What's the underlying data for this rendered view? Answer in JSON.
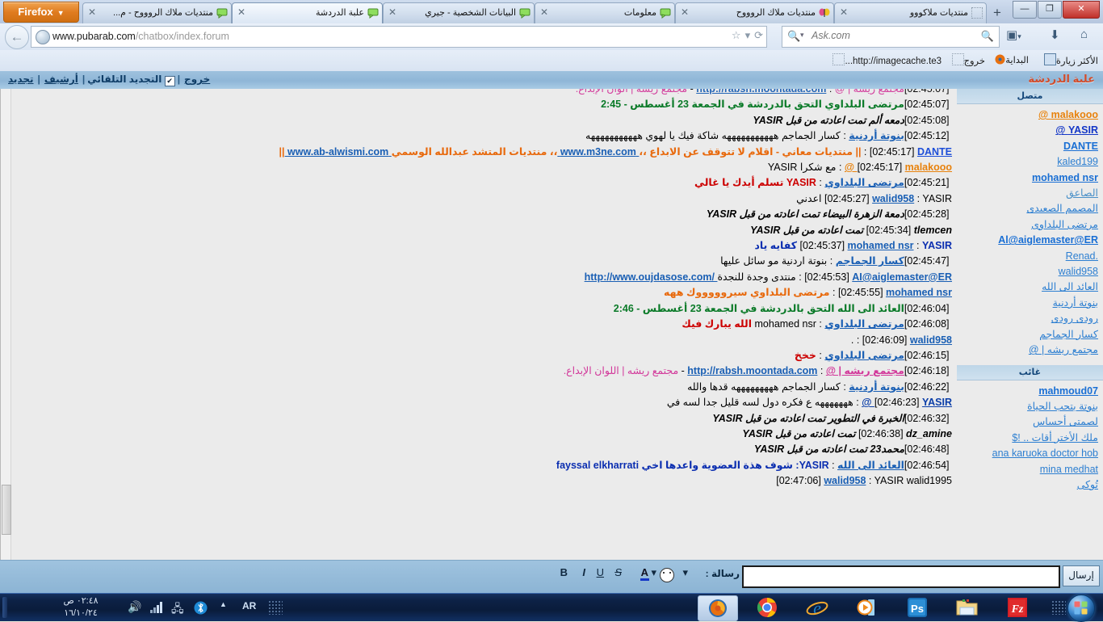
{
  "browser": {
    "firefox_button": "Firefox",
    "tabs": [
      {
        "label": "منتديات ملاك الروووح - م...",
        "active": false,
        "favicon": "chat-bubble-icon"
      },
      {
        "label": "علبة الدردشة",
        "active": true,
        "favicon": "chat-bubble-icon"
      },
      {
        "label": "البيانات الشخصية - جيري",
        "active": false,
        "favicon": "chat-bubble-icon"
      },
      {
        "label": "معلومات",
        "active": false,
        "favicon": "chat-bubble-icon"
      },
      {
        "label": "منتديات ملاك الروووح",
        "active": false,
        "favicon": "butterfly-icon"
      },
      {
        "label": "منتديات ملاكووو",
        "active": false,
        "favicon": "blank-icon"
      }
    ],
    "new_tab_label": "+",
    "window_buttons": {
      "minimize": "—",
      "maximize": "❐",
      "close": "✕"
    },
    "url": {
      "prefix": "www.pubarab.com",
      "suffix": "/chatbox/index.forum"
    },
    "url_star": "☆",
    "url_star_caret": "▾",
    "reload": "⟳",
    "search": {
      "engine_caret": "▾",
      "placeholder": "Ask.com",
      "magnifier": "search-icon"
    },
    "nav_icons": {
      "bookmark": "bookmark-icon",
      "bookmark_caret": "▾",
      "download": "⬇",
      "home": "⌂"
    },
    "bookmarks": [
      {
        "label": "الأكثر زيارة",
        "icon": "most-visited-icon"
      },
      {
        "label": "البداية",
        "icon": "firefox-icon"
      },
      {
        "label": "خروج",
        "icon": "blank-icon"
      },
      {
        "label": "http://imagecache.te3...",
        "icon": "blank-icon"
      }
    ]
  },
  "chat": {
    "title": "علبة الدردشة",
    "toolbar": {
      "refresh": "تجديد",
      "archive": "أرشيف",
      "auto_refresh": "التجديد التلقائي",
      "auto_refresh_checked": "✔",
      "logout": "خروج",
      "separator": "|"
    },
    "messages": [
      {
        "time": "[02:45:07]",
        "type": "cut",
        "parts": [
          {
            "t": "مجتمع ريشه | @",
            "c": "u-pink"
          },
          {
            "t": " : ",
            "c": "body-black"
          },
          {
            "t": "http://rabsh.moontada.com",
            "c": "lnk"
          },
          {
            "t": " - ",
            "c": "body-black"
          },
          {
            "t": "مجتمع ريشه | الوان الإبداع.",
            "c": "body-pink"
          }
        ]
      },
      {
        "time": "[02:45:07]",
        "type": "join",
        "parts": [
          {
            "t": "مرتضى البلداوي التحق بالدردشة في الجمعة 23 أغسطس - 2:45",
            "c": "join"
          }
        ]
      },
      {
        "time": "[02:45:08]",
        "type": "action",
        "parts": [
          {
            "t": "دمعه ألم تمت اعادته من قبل YASIR",
            "c": "ital"
          }
        ]
      },
      {
        "time": "[02:45:12]",
        "type": "msg",
        "parts": [
          {
            "t": "بنوتة أردنية",
            "c": "user u-link"
          },
          {
            "t": " : ",
            "c": "body-black"
          },
          {
            "t": "كسار الجماجم هههههههههههه شاكة فيك يا لهوي هههههههههههه",
            "c": "body-black"
          }
        ]
      },
      {
        "time": "[02:45:17]",
        "type": "msg",
        "parts": [
          {
            "t": "DANTE",
            "c": "user u-blue"
          },
          {
            "t": " : ",
            "c": "body-black"
          },
          {
            "t": "|| ",
            "c": "body-orange"
          },
          {
            "t": "منتديات معاني - اقلام لا تتوقف عن الابداع ،،",
            "c": "body-orange"
          },
          {
            "t": " www.m3ne.com ",
            "c": "lnk"
          },
          {
            "t": "،، منتديات المتشد عبدالله الوسمي",
            "c": "body-orange"
          },
          {
            "t": " www.ab-alwismi.com ",
            "c": "lnk"
          },
          {
            "t": "||",
            "c": "body-orange"
          }
        ]
      },
      {
        "time": "[02:45:17]",
        "type": "msg",
        "parts": [
          {
            "t": "malakooo @",
            "c": "user u-orange"
          },
          {
            "t": " : ",
            "c": "body-black"
          },
          {
            "t": "مع شكرا YASIR",
            "c": "body-black"
          }
        ]
      },
      {
        "time": "[02:45:21]",
        "type": "msg",
        "parts": [
          {
            "t": "مرتضى البلداوي",
            "c": "user u-link"
          },
          {
            "t": " : ",
            "c": "body-black"
          },
          {
            "t": "YASIR تسلم أيدك يا غالي",
            "c": "body-red"
          }
        ]
      },
      {
        "time": "[02:45:27]",
        "type": "msg",
        "parts": [
          {
            "t": "walid958",
            "c": "user u-link"
          },
          {
            "t": " : ",
            "c": "body-black"
          },
          {
            "t": "YASIR اعدني",
            "c": "body-black"
          }
        ]
      },
      {
        "time": "[02:45:28]",
        "type": "action",
        "parts": [
          {
            "t": "دمعة الزهرة البيضاء تمت اعادته من قبل YASIR",
            "c": "ital"
          }
        ]
      },
      {
        "time": "[02:45:34]",
        "type": "action",
        "parts": [
          {
            "t": "tlemcen تمت اعادته من قبل YASIR",
            "c": "ital"
          }
        ]
      },
      {
        "time": "[02:45:37]",
        "type": "msg",
        "parts": [
          {
            "t": "mohamed nsr",
            "c": "user u-link"
          },
          {
            "t": " : ",
            "c": "body-black"
          },
          {
            "t": "YASIR كفايه ياد",
            "c": "body-blue"
          }
        ]
      },
      {
        "time": "[02:45:47]",
        "type": "msg",
        "parts": [
          {
            "t": "كسار الجماجم",
            "c": "user u-link"
          },
          {
            "t": " : ",
            "c": "body-black"
          },
          {
            "t": "بنوتة اردنية مو سائل عليها",
            "c": "body-black"
          }
        ]
      },
      {
        "time": "[02:45:53]",
        "type": "msg",
        "parts": [
          {
            "t": "AI@aiglemaster@ER",
            "c": "user u-link"
          },
          {
            "t": " : ",
            "c": "body-black"
          },
          {
            "t": "منتدى وجدة للنجدة",
            "c": "body-black"
          },
          {
            "t": " /http://www.oujdasose.com",
            "c": "lnk"
          }
        ]
      },
      {
        "time": "[02:45:55]",
        "type": "msg",
        "parts": [
          {
            "t": "mohamed nsr",
            "c": "user u-link"
          },
          {
            "t": " : ",
            "c": "body-black"
          },
          {
            "t": "مرتضى البلداوي سيروووووك ههه",
            "c": "body-orange"
          }
        ]
      },
      {
        "time": "[02:46:04]",
        "type": "join",
        "parts": [
          {
            "t": "العائد الى الله التحق بالدردشة في الجمعة 23 أغسطس - 2:46",
            "c": "join"
          }
        ]
      },
      {
        "time": "[02:46:08]",
        "type": "msg",
        "parts": [
          {
            "t": "مرتضى البلداوي",
            "c": "user u-link"
          },
          {
            "t": " : ",
            "c": "body-black"
          },
          {
            "t": "mohamed nsr ",
            "c": "body-black"
          },
          {
            "t": "الله يبارك فيك",
            "c": "body-red"
          }
        ]
      },
      {
        "time": "[02:46:09]",
        "type": "msg",
        "parts": [
          {
            "t": "walid958",
            "c": "user u-link"
          },
          {
            "t": " : ",
            "c": "body-black"
          },
          {
            "t": ".",
            "c": "body-black"
          }
        ]
      },
      {
        "time": "[02:46:15]",
        "type": "msg",
        "parts": [
          {
            "t": "مرتضى البلداوي",
            "c": "user u-link"
          },
          {
            "t": " : ",
            "c": "body-black"
          },
          {
            "t": "خخخ",
            "c": "body-red"
          }
        ]
      },
      {
        "time": "[02:46:18]",
        "type": "msg",
        "parts": [
          {
            "t": "مجتمع ريشه | @",
            "c": "user u-pink"
          },
          {
            "t": " : ",
            "c": "body-black"
          },
          {
            "t": "http://rabsh.moontada.com",
            "c": "lnk"
          },
          {
            "t": " - ",
            "c": "body-black"
          },
          {
            "t": "مجتمع ريشه | اللوان الإبداع.",
            "c": "body-pink"
          }
        ]
      },
      {
        "time": "[02:46:22]",
        "type": "msg",
        "parts": [
          {
            "t": "بنوتة أردنية",
            "c": "user u-link"
          },
          {
            "t": " : ",
            "c": "body-black"
          },
          {
            "t": "كسار الجماجم هههههههههه قدها والله",
            "c": "body-black"
          }
        ]
      },
      {
        "time": "[02:46:23]",
        "type": "msg",
        "parts": [
          {
            "t": "YASIR @",
            "c": "user u-dblue"
          },
          {
            "t": " : ",
            "c": "body-black"
          },
          {
            "t": "هههههههه ع فكره دول لسه قليل جدا لسه في",
            "c": "body-black"
          }
        ]
      },
      {
        "time": "[02:46:32]",
        "type": "action",
        "parts": [
          {
            "t": "الخبرة في التطوير تمت اعادته من قبل YASIR",
            "c": "ital"
          }
        ]
      },
      {
        "time": "[02:46:38]",
        "type": "action",
        "parts": [
          {
            "t": "dz_amine تمت اعادته من قبل YASIR",
            "c": "ital"
          }
        ]
      },
      {
        "time": "[02:46:48]",
        "type": "action",
        "parts": [
          {
            "t": "محمد23 تمت اعادته من قبل YASIR",
            "c": "ital"
          }
        ]
      },
      {
        "time": "[02:46:54]",
        "type": "msg",
        "parts": [
          {
            "t": "العائد الى الله",
            "c": "user u-link"
          },
          {
            "t": " : ",
            "c": "body-black"
          },
          {
            "t": "YASIR: شوف هذة العضوية واعدها اخي ",
            "c": "body-blue"
          },
          {
            "t": "fayssal elkharrati",
            "c": "body-blue"
          }
        ]
      },
      {
        "time": "[02:47:06]",
        "type": "msg",
        "parts": [
          {
            "t": "walid958",
            "c": "user u-link"
          },
          {
            "t": " : ",
            "c": "body-black"
          },
          {
            "t": "YASIR walid1995",
            "c": "body-black"
          }
        ]
      }
    ],
    "sidebar": {
      "online_header": "متصل",
      "away_header": "غائب",
      "online_users": [
        {
          "name": "malakooo @",
          "color": "#e8820c",
          "bold": true
        },
        {
          "name": "YASIR @",
          "color": "#1437c7",
          "bold": true
        },
        {
          "name": "DANTE",
          "color": "#1a6fd4",
          "bold": true
        },
        {
          "name": "kaled199",
          "color": "#2d7fd1",
          "bold": false
        },
        {
          "name": "mohamed nsr",
          "color": "#1a6fd4",
          "bold": true
        },
        {
          "name": "الصاعق",
          "color": "#4a90c8",
          "bold": false
        },
        {
          "name": "المصمم الصعيدى",
          "color": "#2d7fd1",
          "bold": false
        },
        {
          "name": "مرتضى البلداوى",
          "color": "#2d7fd1",
          "bold": false
        },
        {
          "name": "Al@aiglemaster@ER",
          "color": "#1a6fd4",
          "bold": true
        },
        {
          "name": ".Renad",
          "color": "#2d7fd1",
          "bold": false
        },
        {
          "name": "walid958",
          "color": "#2d7fd1",
          "bold": false
        },
        {
          "name": "العائد الى الله",
          "color": "#2d7fd1",
          "bold": false
        },
        {
          "name": "بنوتة أردنية",
          "color": "#2d7fd1",
          "bold": false
        },
        {
          "name": "رودى رودى",
          "color": "#2d7fd1",
          "bold": false
        },
        {
          "name": "كسار الجماجم",
          "color": "#2d7fd1",
          "bold": false
        },
        {
          "name": "مجتمع ريشه | @",
          "color": "#2d7fd1",
          "bold": false
        }
      ],
      "away_users": [
        {
          "name": "mahmoud07",
          "color": "#1a6fd4",
          "bold": true
        },
        {
          "name": "بنوتة بتحب الحياة",
          "color": "#2d7fd1",
          "bold": false
        },
        {
          "name": "لصمتى أحساس",
          "color": "#2d7fd1",
          "bold": false
        },
        {
          "name": "ملك الأختر أقات .. !$",
          "color": "#2d7fd1",
          "bold": false
        },
        {
          "name": "ana karuoka doctor hob",
          "color": "#2d7fd1",
          "bold": false
        },
        {
          "name": "mina medhat",
          "color": "#2d7fd1",
          "bold": false
        },
        {
          "name": "تُوكى",
          "color": "#2d7fd1",
          "bold": false
        }
      ]
    },
    "input": {
      "send_label": "إرسال",
      "message_value": "",
      "message_label": "رسالة :",
      "format_buttons": [
        {
          "name": "bold",
          "label": "B"
        },
        {
          "name": "italic",
          "label": "I"
        },
        {
          "name": "underline",
          "label": "U"
        },
        {
          "name": "strike",
          "label": "S"
        },
        {
          "name": "color",
          "label": "A"
        },
        {
          "name": "color-caret",
          "label": "▾"
        },
        {
          "name": "smiley",
          "label": "☺"
        },
        {
          "name": "smiley-caret",
          "label": "▾"
        }
      ]
    }
  },
  "taskbar": {
    "clock_time": "٠٢:٤٨ ص",
    "clock_date": "١٦/١٠/٢٤",
    "language": "AR",
    "tray_icons": [
      "volume-icon",
      "signal-icon",
      "network-icon",
      "bluetooth-icon",
      "show-hidden-icon"
    ],
    "launchers": [
      "firefox-icon",
      "chrome-icon",
      "internet-explorer-icon",
      "media-player-icon",
      "photoshop-icon",
      "explorer-icon",
      "filezilla-icon"
    ],
    "start_button": "start-orb-icon"
  },
  "colors": {
    "accent_blue": "#8fb6d7",
    "orange": "#e8820c",
    "link_blue": "#2d7fd1",
    "join_green": "#0a7a28",
    "red": "#cc0000",
    "title_red": "#d24b2a"
  }
}
